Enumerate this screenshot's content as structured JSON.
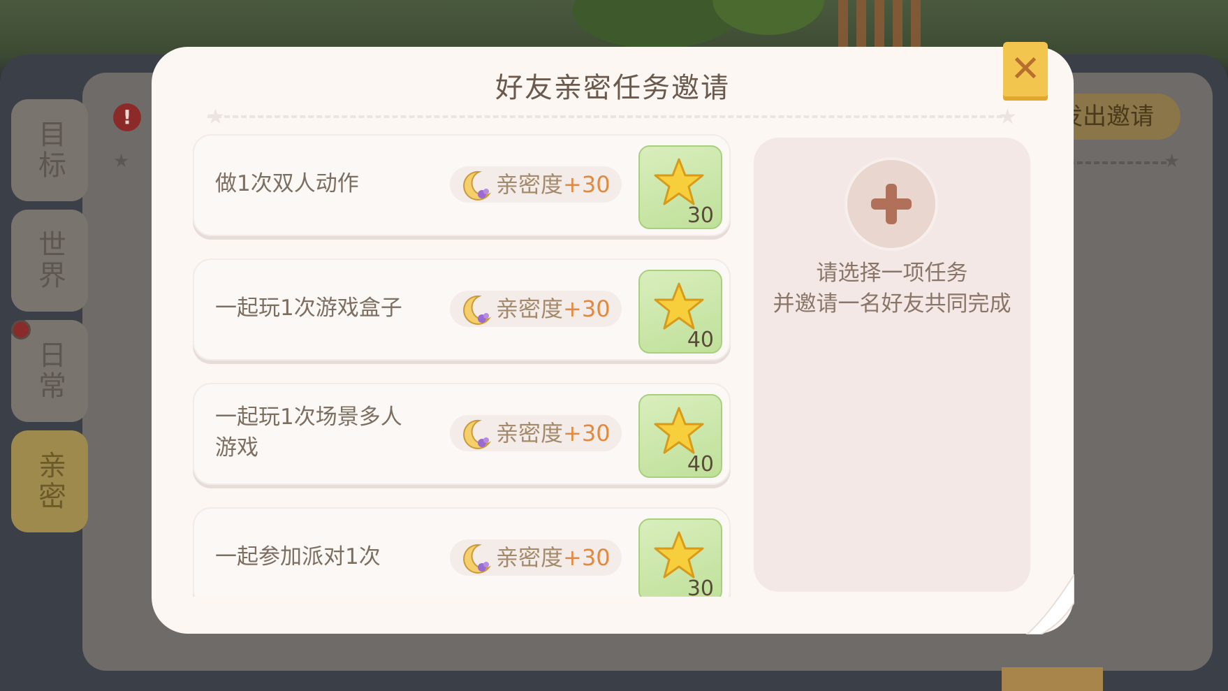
{
  "modal": {
    "title": "好友亲密任务邀请",
    "close_icon": "close-x-icon"
  },
  "tasks": [
    {
      "name": "做1次双人动作",
      "reward_label": "亲密度",
      "reward_value": "+30",
      "star_count": "30"
    },
    {
      "name": "一起玩1次游戏盒子",
      "reward_label": "亲密度",
      "reward_value": "+30",
      "star_count": "40"
    },
    {
      "name": "一起玩1次场景多人游戏",
      "reward_label": "亲密度",
      "reward_value": "+30",
      "star_count": "40"
    },
    {
      "name": "一起参加派对1次",
      "reward_label": "亲密度",
      "reward_value": "+30",
      "star_count": "30"
    }
  ],
  "invite_panel": {
    "line1": "请选择一项任务",
    "line2": "并邀请一名好友共同完成"
  },
  "background": {
    "side_tabs": [
      "目标",
      "世界",
      "日常",
      "亲密"
    ],
    "active_tab": "亲密",
    "invite_button": "发出邀请",
    "alert": "!"
  },
  "colors": {
    "accent_orange": "#e1893e",
    "close_button": "#f2c64e",
    "reward_green": "#bfe09a"
  }
}
